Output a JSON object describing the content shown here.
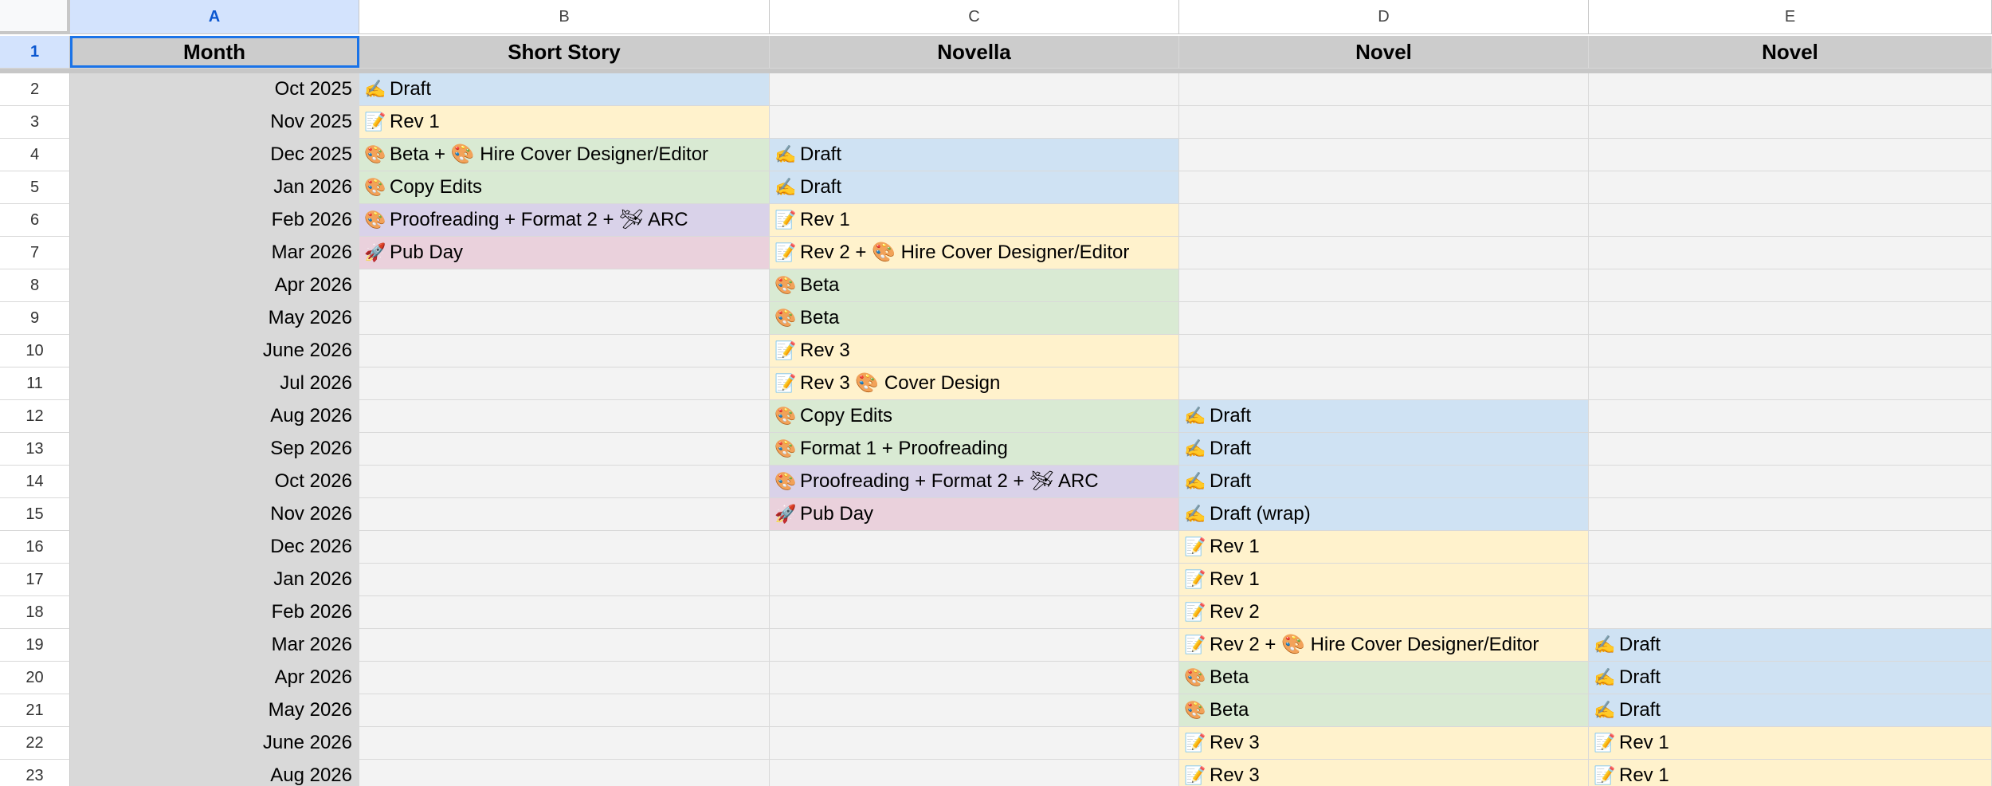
{
  "columns": [
    {
      "letter": "A",
      "selected": true
    },
    {
      "letter": "B",
      "selected": false
    },
    {
      "letter": "C",
      "selected": false
    },
    {
      "letter": "D",
      "selected": false
    },
    {
      "letter": "E",
      "selected": false
    }
  ],
  "header_row": {
    "row_number": "1",
    "cells": [
      "Month",
      "Short Story",
      "Novella",
      "Novel",
      "Novel"
    ]
  },
  "icons": {
    "draft": "writing-hand-icon",
    "rev": "memo-icon",
    "beta": "artist-palette-icon",
    "pub": "rocket-icon",
    "arc": "airplane-icon"
  },
  "colors": {
    "blue": "#cfe2f3",
    "yellow": "#fff2cc",
    "green": "#d9ead3",
    "purple": "#d9d2e9",
    "pink": "#ead1dc",
    "empty": "#f3f3f3",
    "selection": "#1a73e8"
  },
  "rows": [
    {
      "n": "2",
      "month": "Oct 2025",
      "cells": [
        {
          "text": "Draft",
          "icon": "✍",
          "color": "blue"
        },
        null,
        null,
        null
      ]
    },
    {
      "n": "3",
      "month": "Nov 2025",
      "cells": [
        {
          "text": "Rev 1",
          "icon": "📝",
          "color": "yellow"
        },
        null,
        null,
        null
      ]
    },
    {
      "n": "4",
      "month": "Dec 2025",
      "cells": [
        {
          "text": "Beta + 🎨 Hire Cover Designer/Editor",
          "icon": "🎨",
          "color": "green"
        },
        {
          "text": "Draft",
          "icon": "✍",
          "color": "blue"
        },
        null,
        null
      ]
    },
    {
      "n": "5",
      "month": "Jan 2026",
      "cells": [
        {
          "text": "Copy Edits",
          "icon": "🎨",
          "color": "green"
        },
        {
          "text": "Draft",
          "icon": "✍",
          "color": "blue"
        },
        null,
        null
      ]
    },
    {
      "n": "6",
      "month": "Feb 2026",
      "cells": [
        {
          "text": "Proofreading + Format 2 + 🛩 ARC",
          "icon": "🎨",
          "color": "purple"
        },
        {
          "text": "Rev 1",
          "icon": "📝",
          "color": "yellow"
        },
        null,
        null
      ]
    },
    {
      "n": "7",
      "month": "Mar 2026",
      "cells": [
        {
          "text": "Pub Day",
          "icon": "🚀",
          "color": "pink"
        },
        {
          "text": "Rev 2 + 🎨 Hire Cover Designer/Editor",
          "icon": "📝",
          "color": "yellow"
        },
        null,
        null
      ]
    },
    {
      "n": "8",
      "month": "Apr 2026",
      "cells": [
        null,
        {
          "text": "Beta",
          "icon": "🎨",
          "color": "green"
        },
        null,
        null
      ]
    },
    {
      "n": "9",
      "month": "May 2026",
      "cells": [
        null,
        {
          "text": "Beta",
          "icon": "🎨",
          "color": "green"
        },
        null,
        null
      ]
    },
    {
      "n": "10",
      "month": "June 2026",
      "cells": [
        null,
        {
          "text": "Rev 3",
          "icon": "📝",
          "color": "yellow"
        },
        null,
        null
      ]
    },
    {
      "n": "11",
      "month": "Jul 2026",
      "cells": [
        null,
        {
          "text": "Rev 3 🎨 Cover Design",
          "icon": "📝",
          "color": "yellow"
        },
        null,
        null
      ]
    },
    {
      "n": "12",
      "month": "Aug 2026",
      "cells": [
        null,
        {
          "text": "Copy Edits",
          "icon": "🎨",
          "color": "green"
        },
        {
          "text": "Draft",
          "icon": "✍",
          "color": "blue"
        },
        null
      ]
    },
    {
      "n": "13",
      "month": "Sep 2026",
      "cells": [
        null,
        {
          "text": "Format 1 + Proofreading",
          "icon": "🎨",
          "color": "green"
        },
        {
          "text": "Draft",
          "icon": "✍",
          "color": "blue"
        },
        null
      ]
    },
    {
      "n": "14",
      "month": "Oct 2026",
      "cells": [
        null,
        {
          "text": "Proofreading + Format 2 + 🛩 ARC",
          "icon": "🎨",
          "color": "purple"
        },
        {
          "text": "Draft",
          "icon": "✍",
          "color": "blue"
        },
        null
      ]
    },
    {
      "n": "15",
      "month": "Nov 2026",
      "cells": [
        null,
        {
          "text": "Pub Day",
          "icon": "🚀",
          "color": "pink"
        },
        {
          "text": "Draft (wrap)",
          "icon": "✍",
          "color": "blue"
        },
        null
      ]
    },
    {
      "n": "16",
      "month": "Dec 2026",
      "cells": [
        null,
        null,
        {
          "text": "Rev 1",
          "icon": "📝",
          "color": "yellow"
        },
        null
      ]
    },
    {
      "n": "17",
      "month": "Jan 2026",
      "cells": [
        null,
        null,
        {
          "text": "Rev 1",
          "icon": "📝",
          "color": "yellow"
        },
        null
      ]
    },
    {
      "n": "18",
      "month": "Feb 2026",
      "cells": [
        null,
        null,
        {
          "text": "Rev 2",
          "icon": "📝",
          "color": "yellow"
        },
        null
      ]
    },
    {
      "n": "19",
      "month": "Mar 2026",
      "cells": [
        null,
        null,
        {
          "text": "Rev 2 + 🎨 Hire Cover Designer/Editor",
          "icon": "📝",
          "color": "yellow"
        },
        {
          "text": "Draft",
          "icon": "✍",
          "color": "blue"
        }
      ]
    },
    {
      "n": "20",
      "month": "Apr 2026",
      "cells": [
        null,
        null,
        {
          "text": "Beta",
          "icon": "🎨",
          "color": "green"
        },
        {
          "text": "Draft",
          "icon": "✍",
          "color": "blue"
        }
      ]
    },
    {
      "n": "21",
      "month": "May 2026",
      "cells": [
        null,
        null,
        {
          "text": "Beta",
          "icon": "🎨",
          "color": "green"
        },
        {
          "text": "Draft",
          "icon": "✍",
          "color": "blue"
        }
      ]
    },
    {
      "n": "22",
      "month": "June 2026",
      "cells": [
        null,
        null,
        {
          "text": "Rev 3",
          "icon": "📝",
          "color": "yellow"
        },
        {
          "text": "Rev 1",
          "icon": "📝",
          "color": "yellow"
        }
      ]
    },
    {
      "n": "23",
      "month": "Aug 2026",
      "cells": [
        null,
        null,
        {
          "text": "Rev 3",
          "icon": "📝",
          "color": "yellow"
        },
        {
          "text": "Rev 1",
          "icon": "📝",
          "color": "yellow"
        }
      ]
    }
  ]
}
